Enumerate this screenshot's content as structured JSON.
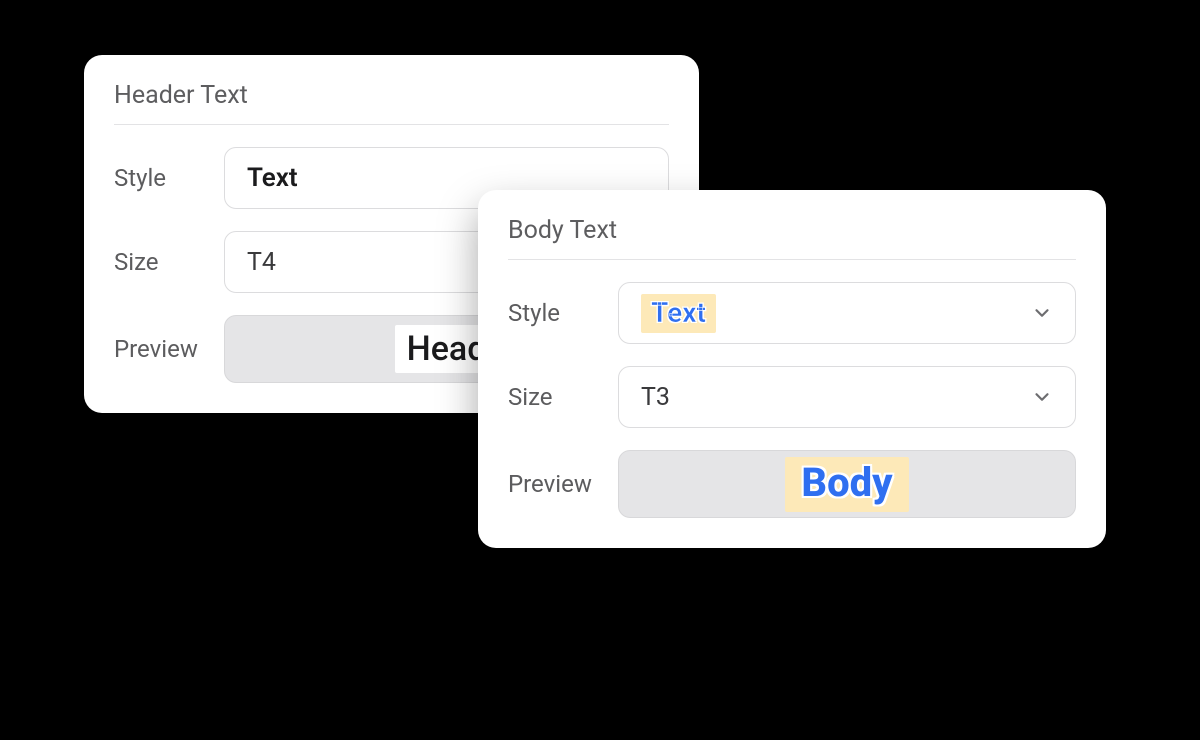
{
  "labels": {
    "style": "Style",
    "size": "Size",
    "preview": "Preview"
  },
  "header_card": {
    "title": "Header Text",
    "style_value": "Text",
    "size_value": "T4",
    "preview_text": "Head"
  },
  "body_card": {
    "title": "Body Text",
    "style_value": "Text",
    "size_value": "T3",
    "preview_text": "Body"
  },
  "colors": {
    "highlight_bg": "#fde9b8",
    "highlight_text": "#2f6ff0",
    "card_bg": "#ffffff",
    "page_bg": "#000000"
  }
}
